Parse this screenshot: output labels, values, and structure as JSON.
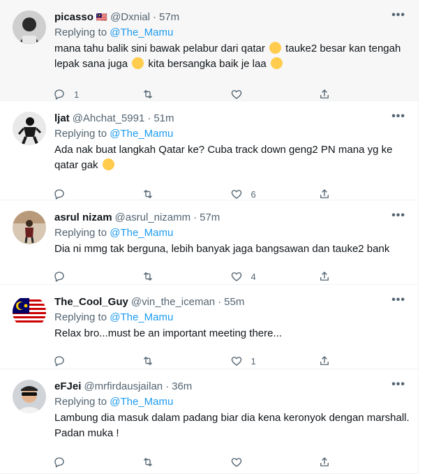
{
  "replies": [
    {
      "name": "picasso",
      "flag": "🇲🇾",
      "handle": "@Dxnial",
      "dot": "·",
      "time": "57m",
      "replying_prefix": "Replying to ",
      "mention": "@The_Mamu",
      "text_a": "mana tahu balik sini bawak pelabur dari qatar ",
      "text_b": " tauke2 besar kan tengah lepak sana juga ",
      "text_c": " kita bersangka baik je laa ",
      "reply_count": "1",
      "retweet_count": "",
      "like_count": ""
    },
    {
      "name": "ljat",
      "handle": "@Ahchat_5991",
      "dot": "·",
      "time": "51m",
      "replying_prefix": "Replying to ",
      "mention": "@The_Mamu",
      "text_a": "Ada nak buat langkah Qatar ke? Cuba track down geng2 PN mana yg ke qatar gak ",
      "reply_count": "",
      "retweet_count": "",
      "like_count": "6"
    },
    {
      "name": "asrul nizam",
      "handle": "@asrul_nizamm",
      "dot": "·",
      "time": "57m",
      "replying_prefix": "Replying to ",
      "mention": "@The_Mamu",
      "text_a": "Dia ni mmg tak berguna, lebih banyak jaga bangsawan dan tauke2 bank",
      "reply_count": "",
      "retweet_count": "",
      "like_count": "4"
    },
    {
      "name": "The_Cool_Guy",
      "handle": "@vin_the_iceman",
      "dot": "·",
      "time": "55m",
      "replying_prefix": "Replying to ",
      "mention": "@The_Mamu",
      "text_a": "Relax bro...must be an important meeting there...",
      "reply_count": "",
      "retweet_count": "",
      "like_count": "1"
    },
    {
      "name": "eFJei",
      "handle": "@mrfirdausjailan",
      "dot": "·",
      "time": "36m",
      "replying_prefix": "Replying to ",
      "mention": "@The_Mamu",
      "text_a": "Lambung dia masuk dalam padang biar dia kena keronyok dengan marshall. Padan muka !",
      "reply_count": "",
      "retweet_count": "",
      "like_count": ""
    }
  ],
  "more_label": "•••",
  "icons": {
    "reply": "reply-icon",
    "retweet": "retweet-icon",
    "like": "heart-icon",
    "share": "share-icon",
    "more": "more-icon"
  },
  "colors": {
    "link": "#1d9bf0",
    "secondary": "#536471",
    "highlight_bg": "#f7f7f7"
  }
}
